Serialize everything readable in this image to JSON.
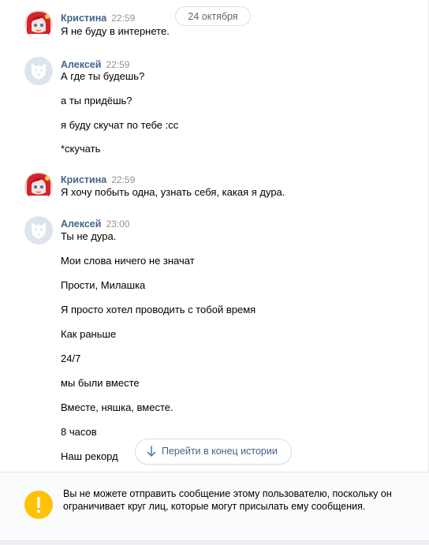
{
  "date_separator": "24 октября",
  "groups": [
    {
      "author": "Кристина",
      "time": "22:59",
      "avatar": "anime-girl-avatar",
      "messages": [
        "Я не буду в интернете."
      ]
    },
    {
      "author": "Алексей",
      "time": "22:59",
      "avatar": "deactivated-dog-avatar",
      "messages": [
        "А где ты будешь?",
        "а ты придёшь?",
        "я буду скучат по тебе :cc",
        "*скучать"
      ]
    },
    {
      "author": "Кристина",
      "time": "22:59",
      "avatar": "anime-girl-avatar",
      "messages": [
        "Я хочу побыть одна, узнать себя, какая я дура."
      ]
    },
    {
      "author": "Алексей",
      "time": "23:00",
      "avatar": "deactivated-dog-avatar",
      "messages": [
        "Ты не дура.",
        "Мои слова ничего не значат",
        "Прости, Милашка",
        "Я просто хотел проводить с тобой время",
        "Как раньше",
        "24/7",
        "мы были вместе",
        "Вместе, няшка, вместе.",
        "8 часов",
        "Наш рекорд"
      ]
    }
  ],
  "jump_button": {
    "label": "Перейти в конец истории",
    "icon": "arrow-down-icon"
  },
  "notice": {
    "icon": "exclamation-icon",
    "accent_color": "#ffc107",
    "text": "Вы не можете отправить сообщение этому пользователю, поскольку он ограничивает круг лиц, которые могут присылать ему сообщения."
  }
}
